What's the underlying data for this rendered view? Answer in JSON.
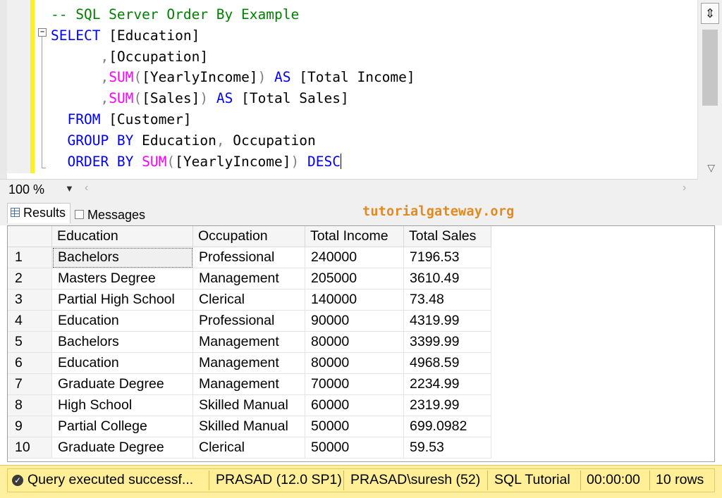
{
  "editor": {
    "line1": "-- SQL Server Order By Example",
    "kw_select": "SELECT",
    "col1": " [Education]",
    "comma": ",",
    "col2": "[Occupation]",
    "sum": "SUM",
    "paren_open": "(",
    "paren_close": ")",
    "yearly": "[YearlyIncome]",
    "kw_as": " AS ",
    "alias1": "[Total Income]",
    "sales": "[Sales]",
    "alias2": "[Total Sales]",
    "kw_from": "FROM",
    "table": " [Customer]",
    "kw_group": "GROUP BY",
    "group_cols_a": " Education",
    "group_cols_b": " Occupation",
    "kw_order": "ORDER BY",
    "kw_desc": " DESC",
    "space": " "
  },
  "zoom": {
    "value": "100 %"
  },
  "tabs": {
    "results": "Results",
    "messages": "Messages"
  },
  "watermark": "tutorialgateway.org",
  "grid": {
    "headers": [
      "",
      "Education",
      "Occupation",
      "Total Income",
      "Total Sales"
    ],
    "rows": [
      [
        "1",
        "Bachelors",
        "Professional",
        "240000",
        "7196.53"
      ],
      [
        "2",
        "Masters Degree",
        "Management",
        "205000",
        "3610.49"
      ],
      [
        "3",
        "Partial High School",
        "Clerical",
        "140000",
        "73.48"
      ],
      [
        "4",
        "Education",
        "Professional",
        "90000",
        "4319.99"
      ],
      [
        "5",
        "Bachelors",
        "Management",
        "80000",
        "3399.99"
      ],
      [
        "6",
        "Education",
        "Management",
        "80000",
        "4968.59"
      ],
      [
        "7",
        "Graduate Degree",
        "Management",
        "70000",
        "2234.99"
      ],
      [
        "8",
        "High School",
        "Skilled Manual",
        "60000",
        "2319.99"
      ],
      [
        "9",
        "Partial College",
        "Skilled Manual",
        "50000",
        "699.0982"
      ],
      [
        "10",
        "Graduate Degree",
        "Clerical",
        "50000",
        "59.53"
      ]
    ]
  },
  "status": {
    "message": "Query executed successf...",
    "server": "PRASAD (12.0 SP1)",
    "user": "PRASAD\\suresh (52)",
    "database": "SQL Tutorial",
    "elapsed": "00:00:00",
    "rows": "10 rows"
  }
}
